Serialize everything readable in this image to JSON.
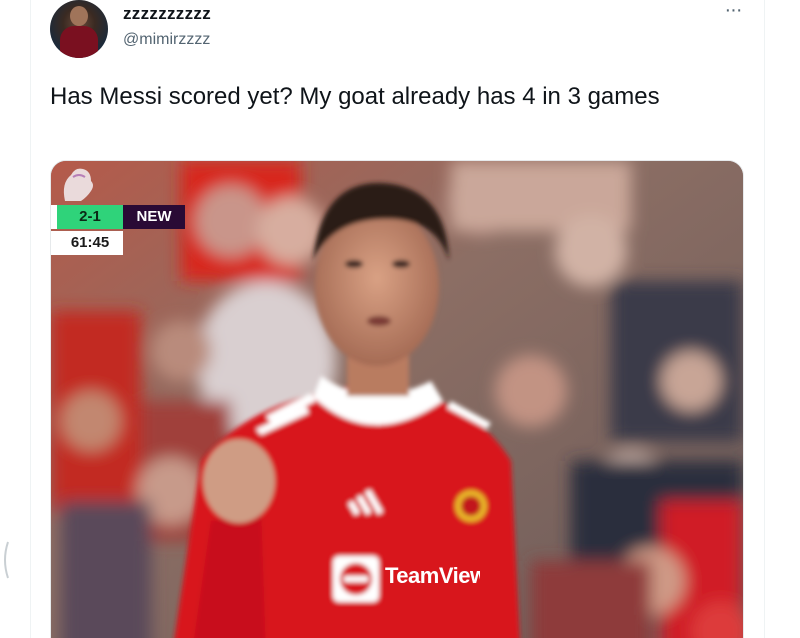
{
  "tweet": {
    "display_name": "zzzzzzzzzz",
    "handle": "@mimirzzzz",
    "more_icon": "more-horizontal-icon",
    "more_glyph": "···",
    "text": "Has Messi scored yet? My goat already has 4 in 3 games"
  },
  "media": {
    "scorebug": {
      "score": "2-1",
      "team": "NEW",
      "clock": "61:45"
    },
    "kit_sponsor": "TeamViewer",
    "colors": {
      "score_green": "#2fd37a",
      "team_purple": "#2a0a35",
      "kit_red": "#d8121a"
    }
  }
}
